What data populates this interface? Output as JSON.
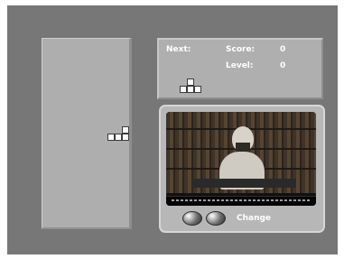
{
  "colors": {
    "background": "#777777",
    "panel": "#afafaf",
    "board": "#aeaeae",
    "text": "#ffffff"
  },
  "panel": {
    "next_label": "Next:",
    "score_label": "Score:",
    "score_value": "0",
    "level_label": "Level:",
    "level_value": "0"
  },
  "controls": {
    "button_labels": [
      "",
      ""
    ],
    "change_label": "Change"
  },
  "icons": {
    "left": "round-button",
    "right": "round-button"
  }
}
